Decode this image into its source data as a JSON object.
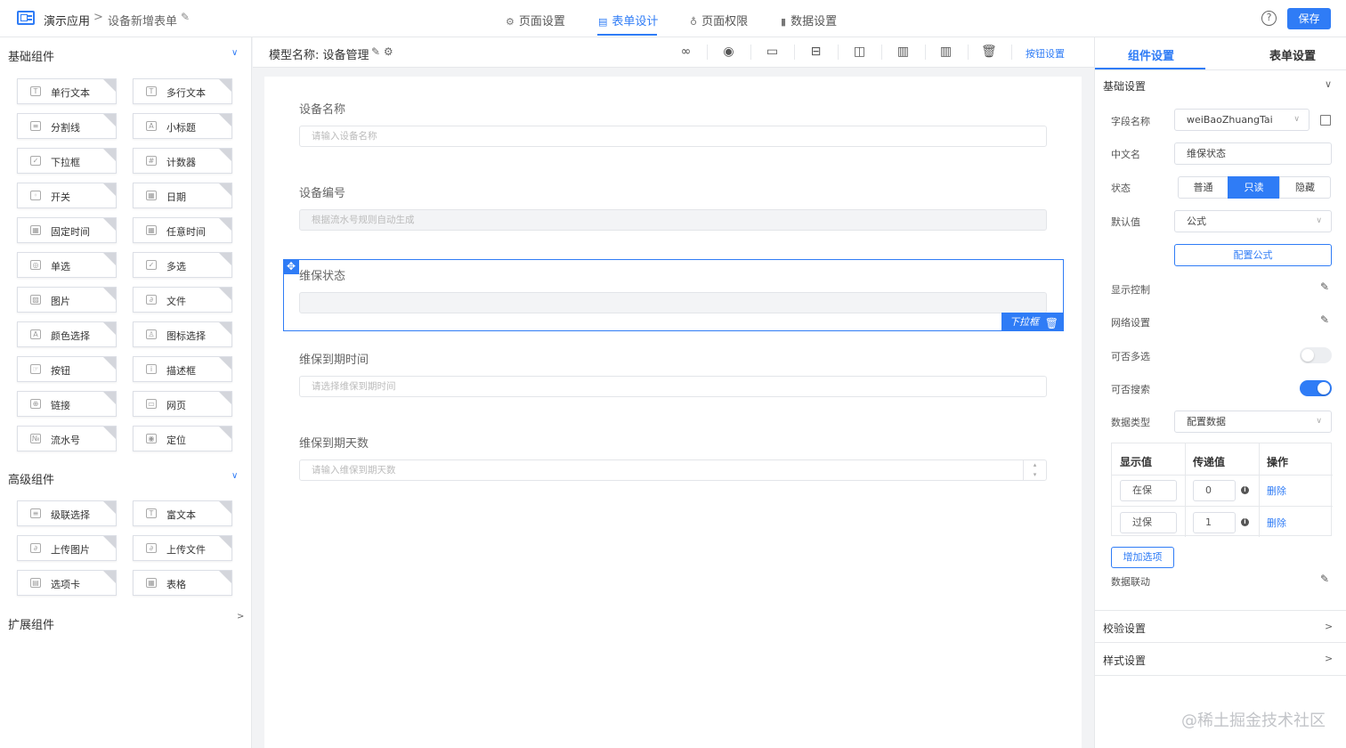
{
  "header": {
    "app_name": "演示应用",
    "breadcrumb_sep": ">",
    "form_name": "设备新增表单",
    "tabs": [
      {
        "label": "页面设置",
        "icon": "gear-icon",
        "glyph": "⚙"
      },
      {
        "label": "表单设计",
        "icon": "document-icon",
        "glyph": "▤"
      },
      {
        "label": "页面权限",
        "icon": "lock-icon",
        "glyph": "♁"
      },
      {
        "label": "数据设置",
        "icon": "bar-chart-icon",
        "glyph": "▮"
      }
    ],
    "active_tab": "表单设计",
    "help_glyph": "?",
    "save_label": "保存"
  },
  "left": {
    "basic_title": "基础组件",
    "basic": [
      {
        "label": "单行文本",
        "icon": "T"
      },
      {
        "label": "多行文本",
        "icon": "T"
      },
      {
        "label": "分割线",
        "icon": "≡"
      },
      {
        "label": "小标题",
        "icon": "A"
      },
      {
        "label": "下拉框",
        "icon": "✓"
      },
      {
        "label": "计数器",
        "icon": "#"
      },
      {
        "label": "开关",
        "icon": "◦"
      },
      {
        "label": "日期",
        "icon": "▦"
      },
      {
        "label": "固定时间",
        "icon": "▦"
      },
      {
        "label": "任意时间",
        "icon": "▦"
      },
      {
        "label": "单选",
        "icon": "◎"
      },
      {
        "label": "多选",
        "icon": "✓"
      },
      {
        "label": "图片",
        "icon": "▨"
      },
      {
        "label": "文件",
        "icon": "∂"
      },
      {
        "label": "颜色选择",
        "icon": "A"
      },
      {
        "label": "图标选择",
        "icon": "♙"
      },
      {
        "label": "按钮",
        "icon": "☞"
      },
      {
        "label": "描述框",
        "icon": "i"
      },
      {
        "label": "链接",
        "icon": "⊕"
      },
      {
        "label": "网页",
        "icon": "▭"
      },
      {
        "label": "流水号",
        "icon": "№"
      },
      {
        "label": "定位",
        "icon": "◉"
      }
    ],
    "advanced_title": "高级组件",
    "advanced": [
      {
        "label": "级联选择",
        "icon": "≡"
      },
      {
        "label": "富文本",
        "icon": "T"
      },
      {
        "label": "上传图片",
        "icon": "∂"
      },
      {
        "label": "上传文件",
        "icon": "∂"
      },
      {
        "label": "选项卡",
        "icon": "▤"
      },
      {
        "label": "表格",
        "icon": "▦"
      }
    ],
    "ext_title": "扩展组件"
  },
  "canvas": {
    "model_label": "模型名称: 设备管理",
    "model_icons": "✎ ⚙",
    "toolbar": [
      {
        "name": "link-icon",
        "glyph": "∞"
      },
      {
        "name": "eye-icon",
        "glyph": "◉"
      },
      {
        "name": "single-column-icon",
        "glyph": "▭"
      },
      {
        "name": "split-rows-icon",
        "glyph": "⊟"
      },
      {
        "name": "two-columns-icon",
        "glyph": "◫"
      },
      {
        "name": "three-columns-icon",
        "glyph": "▥"
      },
      {
        "name": "four-columns-icon",
        "glyph": "▥"
      },
      {
        "name": "trash-icon",
        "glyph": "🗑"
      }
    ],
    "button_settings": "按钮设置",
    "fields": [
      {
        "label": "设备名称",
        "placeholder": "请输入设备名称"
      },
      {
        "label": "设备编号",
        "placeholder": "根据流水号规则自动生成"
      },
      {
        "label": "维保状态",
        "placeholder": ""
      },
      {
        "label": "维保到期时间",
        "placeholder": "请选择维保到期时间"
      },
      {
        "label": "维保到期天数",
        "placeholder": "请输入维保到期天数"
      }
    ],
    "selected_tag": "下拉框",
    "drag_glyph": "✥",
    "trash_glyph": "🗑",
    "number_arrows": "▴\n▾"
  },
  "right": {
    "tabs": [
      "组件设置",
      "表单设置"
    ],
    "basic_settings": "基础设置",
    "field_name_label": "字段名称",
    "field_name_value": "weiBaoZhuangTai",
    "cn_name_label": "中文名",
    "cn_name_value": "维保状态",
    "state_label": "状态",
    "state_options": [
      "普通",
      "只读",
      "隐藏"
    ],
    "state_selected": "只读",
    "default_label": "默认值",
    "default_value": "公式",
    "formula_btn": "配置公式",
    "display_control": "显示控制",
    "grid_settings": "网络设置",
    "multi_label": "可否多选",
    "multi_on": false,
    "search_label": "可否搜索",
    "search_on": true,
    "data_type_label": "数据类型",
    "data_type_value": "配置数据",
    "table_headers": [
      "显示值",
      "传递值",
      "操作"
    ],
    "options": [
      {
        "display": "在保",
        "value": "0",
        "action": "删除"
      },
      {
        "display": "过保",
        "value": "1",
        "action": "删除"
      }
    ],
    "add_option": "增加选项",
    "data_linkage": "数据联动",
    "validation": "校验设置",
    "style_settings": "样式设置",
    "chev_down": "∨",
    "chev_right": ">",
    "dd_arrow": "∨",
    "edit_glyph": "✎",
    "info_glyph": "i"
  },
  "watermark": "@稀土掘金技术社区",
  "colors": {
    "accent": "#2f7cf6"
  }
}
